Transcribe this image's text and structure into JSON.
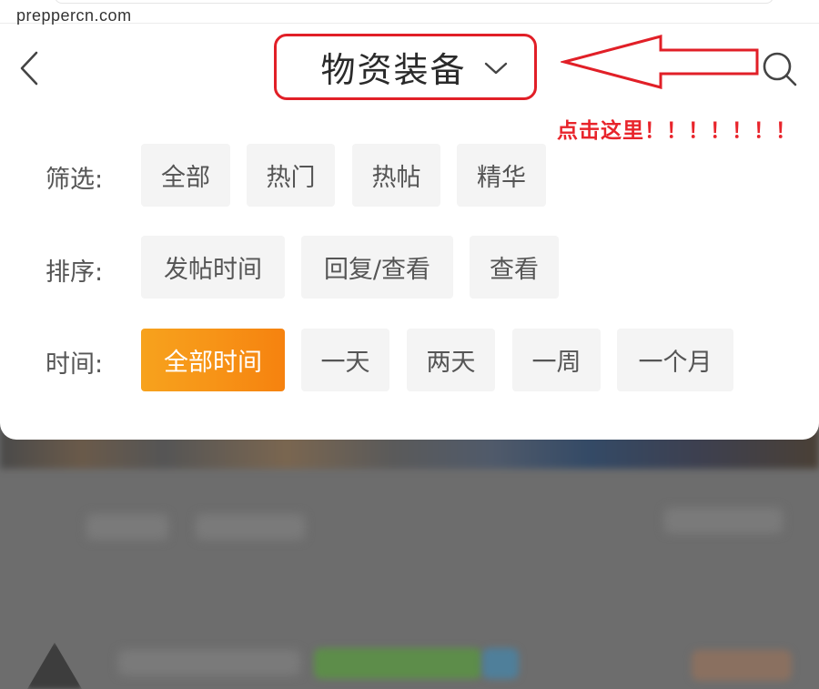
{
  "watermark": "preppercn.com",
  "header": {
    "title": "物资装备",
    "back_icon": "chevron-left-icon",
    "search_icon": "search-icon",
    "dropdown_icon": "chevron-down-icon"
  },
  "annotation": {
    "hint": "点击这里！！！！！！！",
    "color": "#e11f27"
  },
  "filters": {
    "filter": {
      "label": "筛选:",
      "options": [
        "全部",
        "热门",
        "热帖",
        "精华"
      ]
    },
    "sort": {
      "label": "排序:",
      "options": [
        "发帖时间",
        "回复/查看",
        "查看"
      ]
    },
    "time": {
      "label": "时间:",
      "options": [
        "全部时间",
        "一天",
        "两天",
        "一周",
        "一个月"
      ],
      "selected": "全部时间"
    }
  },
  "colors": {
    "accent": "#f79417",
    "chip_bg": "#f4f4f4",
    "annotation_red": "#e11f27"
  }
}
